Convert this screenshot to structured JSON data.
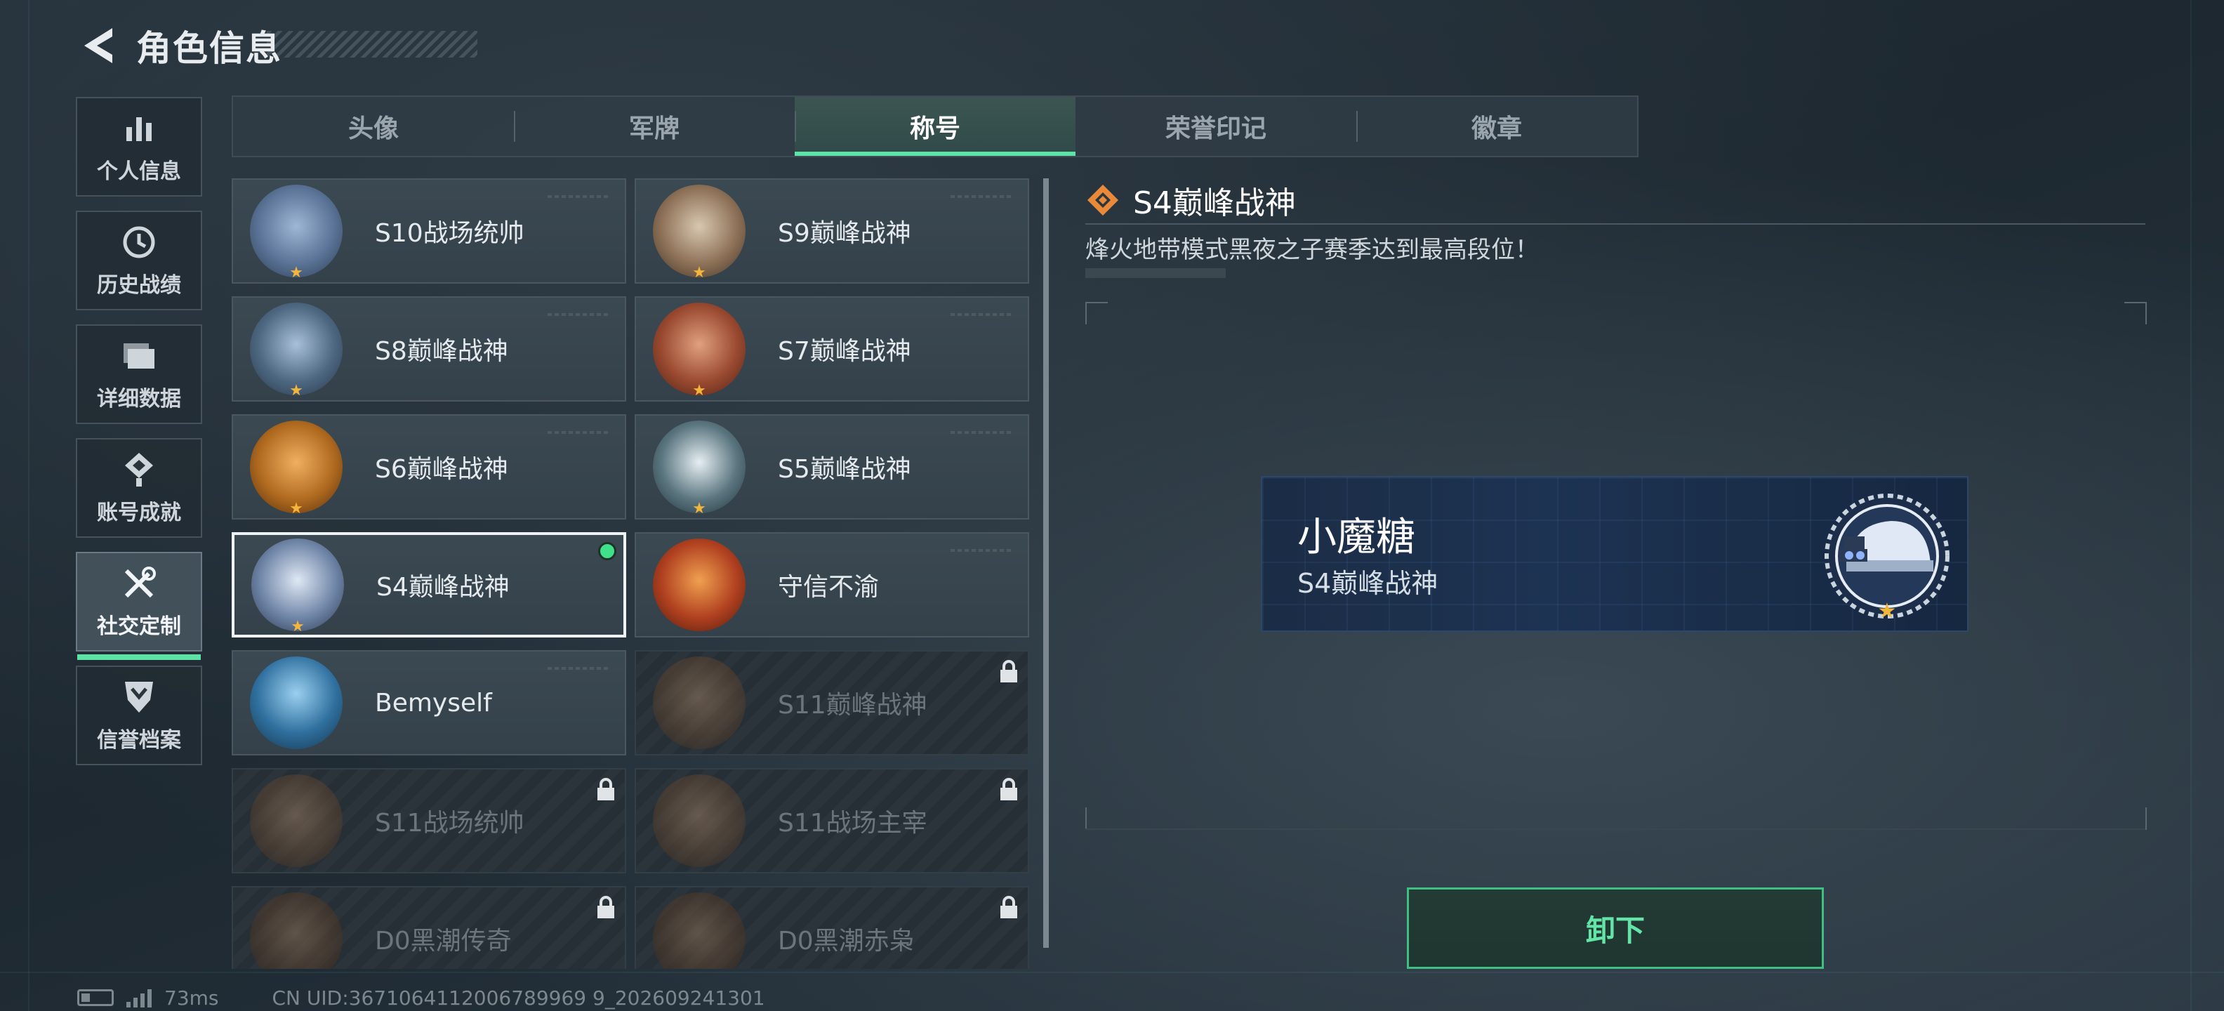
{
  "header": {
    "title": "角色信息",
    "back_icon": "back-arrow-icon"
  },
  "sidebar": {
    "items": [
      {
        "label": "个人信息",
        "icon": "bar-chart-icon",
        "active": false
      },
      {
        "label": "历史战绩",
        "icon": "clock-icon",
        "active": false
      },
      {
        "label": "详细数据",
        "icon": "folder-icon",
        "active": false
      },
      {
        "label": "账号成就",
        "icon": "achievement-icon",
        "active": false
      },
      {
        "label": "社交定制",
        "icon": "wrench-screwdriver-icon",
        "active": true
      },
      {
        "label": "信誉档案",
        "icon": "shield-chevron-icon",
        "active": false
      }
    ]
  },
  "tabs": [
    {
      "label": "头像",
      "active": false
    },
    {
      "label": "军牌",
      "active": false
    },
    {
      "label": "称号",
      "active": true
    },
    {
      "label": "荣誉印记",
      "active": false
    },
    {
      "label": "徽章",
      "active": false
    }
  ],
  "titles": [
    {
      "label": "S10战场统帅",
      "locked": false,
      "selected": false
    },
    {
      "label": "S9巅峰战神",
      "locked": false,
      "selected": false
    },
    {
      "label": "S8巅峰战神",
      "locked": false,
      "selected": false
    },
    {
      "label": "S7巅峰战神",
      "locked": false,
      "selected": false
    },
    {
      "label": "S6巅峰战神",
      "locked": false,
      "selected": false
    },
    {
      "label": "S5巅峰战神",
      "locked": false,
      "selected": false
    },
    {
      "label": "S4巅峰战神",
      "locked": false,
      "selected": true
    },
    {
      "label": "守信不渝",
      "locked": false,
      "selected": false
    },
    {
      "label": "Bemyself",
      "locked": false,
      "selected": false
    },
    {
      "label": "S11巅峰战神",
      "locked": true,
      "selected": false
    },
    {
      "label": "S11战场统帅",
      "locked": true,
      "selected": false
    },
    {
      "label": "S11战场主宰",
      "locked": true,
      "selected": false
    },
    {
      "label": "D0黑潮传奇",
      "locked": true,
      "selected": false
    },
    {
      "label": "D0黑潮赤枭",
      "locked": true,
      "selected": false
    }
  ],
  "detail": {
    "title": "S4巅峰战神",
    "description": "烽火地带模式黑夜之子赛季达到最高段位！"
  },
  "preview": {
    "player_name": "小魔糖",
    "title": "S4巅峰战神"
  },
  "actions": {
    "unequip_label": "卸下"
  },
  "status_bar": {
    "ping": "73ms",
    "uid": "CN UID:3671064112006789969 9_202609241301"
  },
  "colors": {
    "accent_green": "#5ee2a6",
    "star_gold": "#f4b63a",
    "online_dot": "#3fe089"
  }
}
